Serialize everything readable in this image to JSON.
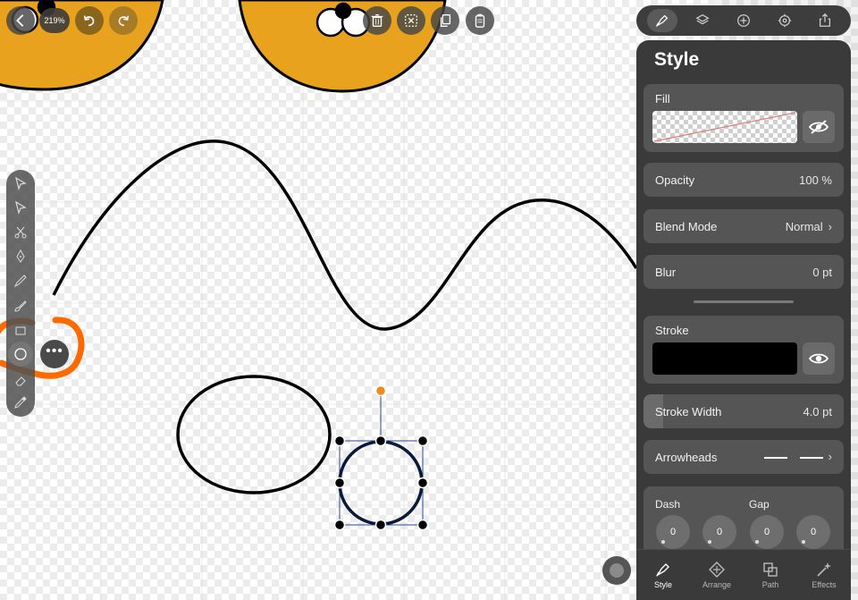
{
  "toolbar": {
    "zoom_label": "219%",
    "icons": [
      "back-icon",
      "undo-icon",
      "redo-icon",
      "delete-icon",
      "deselect-icon",
      "duplicate-icon",
      "clipboard-icon"
    ]
  },
  "tools": [
    "select-icon",
    "direct-select-icon",
    "scissors-icon",
    "pen-icon",
    "pencil-icon",
    "brush-icon",
    "shape-icon",
    "eraser-icon",
    "eyedropper-icon"
  ],
  "active_tool": "ellipse-icon",
  "panel_tabs": [
    "style-tab-icon",
    "layers-icon",
    "add-icon",
    "settings-icon",
    "share-icon"
  ],
  "style_panel": {
    "title": "Style",
    "fill_label": "Fill",
    "opacity_label": "Opacity",
    "opacity_value": "100 %",
    "blend_label": "Blend Mode",
    "blend_value": "Normal",
    "blur_label": "Blur",
    "blur_value": "0 pt",
    "stroke_label": "Stroke",
    "stroke_color": "#000000",
    "stroke_width_label": "Stroke Width",
    "stroke_width_value": "4.0 pt",
    "stroke_width_fraction": 0.1,
    "arrowheads_label": "Arrowheads",
    "dash_label": "Dash",
    "gap_label": "Gap",
    "dash_values": [
      "0",
      "0",
      "0",
      "0"
    ]
  },
  "bottom_tabs": [
    {
      "label": "Style",
      "icon": "style-icon"
    },
    {
      "label": "Arrange",
      "icon": "arrange-icon"
    },
    {
      "label": "Path",
      "icon": "path-icon"
    },
    {
      "label": "Effects",
      "icon": "effects-icon"
    }
  ],
  "colors": {
    "accent_orange": "#ff6a00",
    "face_fill": "#e8a21d",
    "handle_orange": "#f08a1c",
    "panel_bg": "#3a3a3a",
    "card_bg": "#555555"
  }
}
